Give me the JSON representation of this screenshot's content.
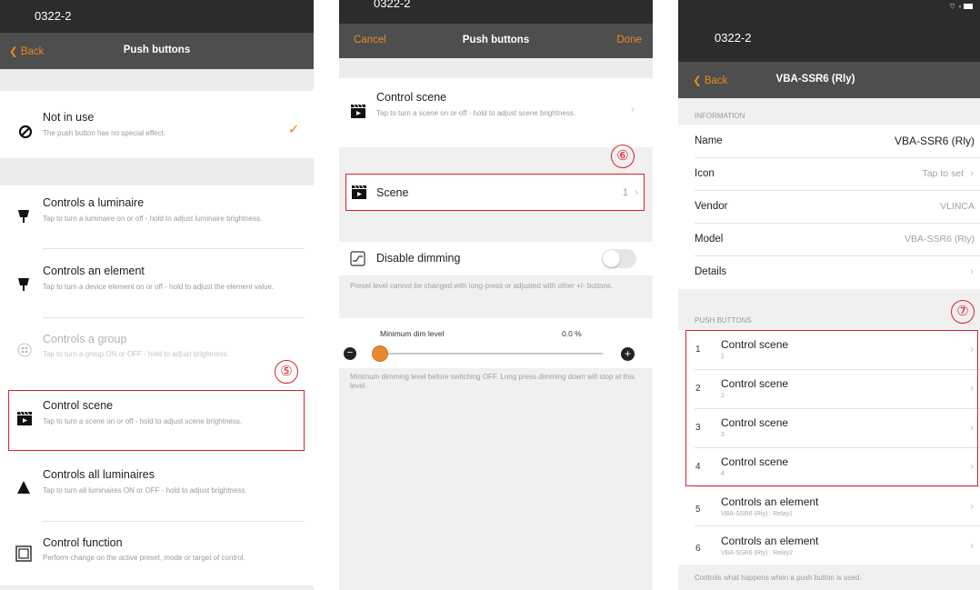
{
  "screen1": {
    "carrier": "0322-2",
    "back_label": "Back",
    "title": "Push buttons",
    "marker": "⑤",
    "checkmark": "✓",
    "options": [
      {
        "title": "Not in use",
        "subtitle": "The push button has no special effect.",
        "icon": "prohibited-icon"
      },
      {
        "title": "Controls a luminaire",
        "subtitle": "Tap to turn a luminaire on or off - hold to adjust luminaire brightness.",
        "icon": "luminaire-icon"
      },
      {
        "title": "Controls an element",
        "subtitle": "Tap to turn a device element on or off - hold to adjust the element value.",
        "icon": "luminaire-icon"
      },
      {
        "title": "Controls a group",
        "subtitle": "Tap to turn a group ON or OFF - hold to adjust brightness.",
        "icon": "group-icon"
      },
      {
        "title": "Control scene",
        "subtitle": "Tap to turn a scene on or off - hold to adjust scene brightness.",
        "icon": "clapperboard-icon"
      },
      {
        "title": "Controls all luminaires",
        "subtitle": "Tap to turn all luminaires ON or OFF - hold to adjust brightness.",
        "icon": "triangle-icon"
      },
      {
        "title": "Control function",
        "subtitle": "Perform change on the active preset, mode or target of control.",
        "icon": "square-icon"
      }
    ]
  },
  "screen2": {
    "carrier": "0322-2",
    "cancel_label": "Cancel",
    "title": "Push buttons",
    "done_label": "Done",
    "marker": "⑥",
    "control_scene": {
      "title": "Control scene",
      "subtitle": "Tap to turn a scene on or off - hold to adjust scene brightness."
    },
    "scene": {
      "label": "Scene",
      "value": "1"
    },
    "disable_dimming": {
      "label": "Disable dimming",
      "enabled": false
    },
    "preset_note": "Preset level cannot be changed with long-press or adjusted with other +/- buttons.",
    "min_dim": {
      "label": "Minimum dim level",
      "value_text": "0.0 %",
      "fraction": 0.0
    },
    "min_dim_note": "Minimum dimming level before switching OFF. Long press dimming down will stop at this level."
  },
  "screen3": {
    "carrier": "0322-2",
    "back_label": "Back",
    "title": "VBA-SSR6 (Rly)",
    "marker": "⑦",
    "information_header": "INFORMATION",
    "info": [
      {
        "label": "Name",
        "value": "VBA-SSR6 (Rly)"
      },
      {
        "label": "Icon",
        "value": "Tap to set"
      },
      {
        "label": "Vendor",
        "value": "VLINCA"
      },
      {
        "label": "Model",
        "value": "VBA-SSR6 (Rly)"
      },
      {
        "label": "Details",
        "value": ""
      }
    ],
    "push_buttons_header": "PUSH BUTTONS",
    "buttons": [
      {
        "num": "1",
        "title": "Control scene",
        "sub": "1"
      },
      {
        "num": "2",
        "title": "Control scene",
        "sub": "2"
      },
      {
        "num": "3",
        "title": "Control scene",
        "sub": "3"
      },
      {
        "num": "4",
        "title": "Control scene",
        "sub": "4"
      },
      {
        "num": "5",
        "title": "Controls an element",
        "sub": "VBA-SSR6 (Rly) : Relay1"
      },
      {
        "num": "6",
        "title": "Controls an element",
        "sub": "VBA-SSR6 (Rly) : Relay2"
      }
    ],
    "footer": "Controls what happens when a push button is used."
  },
  "colors": {
    "accent": "#e8891f",
    "marker_red": "#d9232b",
    "navbar": "#4e4e4e",
    "statusbar": "#2c2c2c"
  }
}
